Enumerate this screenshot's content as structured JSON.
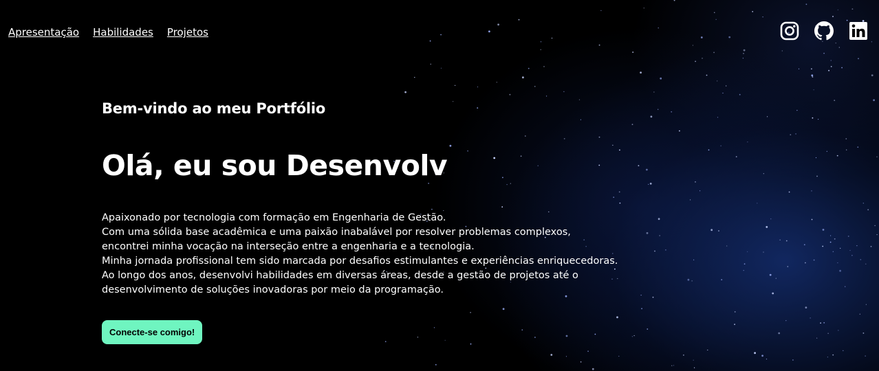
{
  "nav": {
    "items": [
      {
        "label": "Apresentação"
      },
      {
        "label": "Habilidades"
      },
      {
        "label": "Projetos"
      }
    ]
  },
  "social": {
    "icons": [
      "instagram-icon",
      "github-icon",
      "linkedin-icon"
    ]
  },
  "hero": {
    "welcome": "Bem-vindo ao meu Portfólio",
    "headline": "Olá, eu sou Desenvolv",
    "bio": [
      "Apaixonado por tecnologia com formação em Engenharia de Gestão.",
      "Com uma sólida base acadêmica e uma paixão inabalável por resolver problemas complexos,",
      "encontrei minha vocação na interseção entre a engenharia e a tecnologia.",
      "Minha jornada profissional tem sido marcada por desafios estimulantes e experiências enriquecedoras.",
      "Ao longo dos anos, desenvolvi habilidades em diversas áreas, desde a gestão de projetos até o",
      "desenvolvimento de soluções inovadoras por meio da programação."
    ],
    "cta_label": "Conecte-se comigo!"
  },
  "colors": {
    "background": "#000000",
    "space_blue": "#142d6e",
    "text": "#ffffff",
    "cta_background": "#6ff5c0",
    "cta_text": "#000000"
  }
}
